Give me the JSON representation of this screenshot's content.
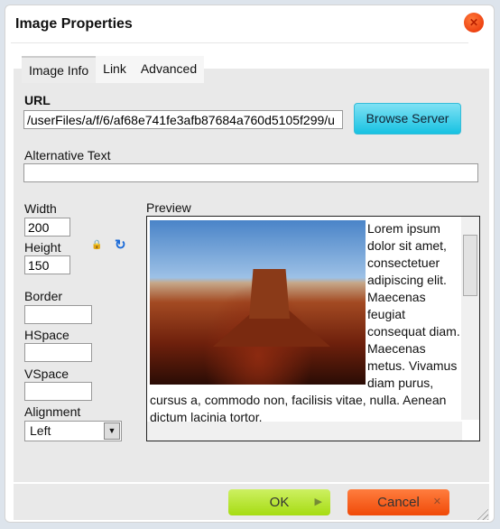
{
  "dialog": {
    "title": "Image Properties",
    "close_icon": "close-icon"
  },
  "tabs": [
    {
      "label": "Image Info",
      "active": true
    },
    {
      "label": "Link"
    },
    {
      "label": "Advanced"
    }
  ],
  "url": {
    "label": "URL",
    "value": "/userFiles/a/f/6/af68e741fe3afb87684a760d5105f299/u",
    "browse": "Browse Server"
  },
  "alt": {
    "label": "Alternative Text",
    "value": ""
  },
  "width": {
    "label": "Width",
    "value": "200"
  },
  "height": {
    "label": "Height",
    "value": "150"
  },
  "border": {
    "label": "Border",
    "value": ""
  },
  "hspace": {
    "label": "HSpace",
    "value": ""
  },
  "vspace": {
    "label": "VSpace",
    "value": ""
  },
  "alignment": {
    "label": "Alignment",
    "value": "Left"
  },
  "preview": {
    "label": "Preview",
    "text": "Lorem ipsum dolor sit amet, consectetuer adipiscing elit. Maecenas feugiat consequat diam. Maecenas metus. Vivamus diam purus, cursus a, commodo non, facilisis vitae, nulla. Aenean dictum lacinia tortor."
  },
  "footer": {
    "ok": "OK",
    "cancel": "Cancel"
  },
  "colors": {
    "ok": "#a6dc12",
    "cancel": "#f04a08",
    "browse": "#17c2e2"
  }
}
